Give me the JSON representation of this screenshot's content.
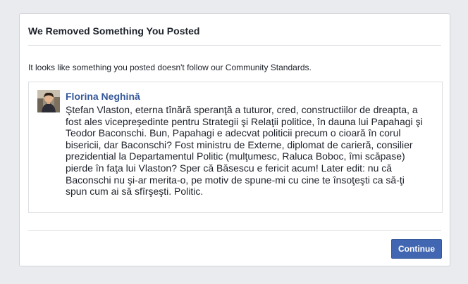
{
  "dialog": {
    "title": "We Removed Something You Posted",
    "message": "It looks like something you posted doesn't follow our Community Standards.",
    "continue_label": "Continue"
  },
  "post": {
    "author": "Florina Neghină",
    "text": "Ştefan Vlaston, eterna tînără speranţă a tuturor, cred, constructiilor de dreapta, a\nfost ales vicepreşedinte pentru Strategii şi Relaţii politice, în dauna lui Papahagi şi\nTeodor Baconschi. Bun, Papahagi e adecvat politicii precum o cioară în corul\nbisericii, dar Baconschi? Fost ministru de Externe, diplomat de carieră, consilier\nprezidential la Departamentul Politic (mulţumesc, Raluca Boboc, îmi scăpase)\npierde în faţa lui Vlaston? Sper că Băsescu e fericit acum! Later edit: nu că\nBaconschi nu şi-ar merita-o, pe motiv de spune-mi cu cine te însoţeşti ca să-ţi\nspun cum ai să sfîrşeşti. Politic.",
    "avatar_icon": "user-photo"
  },
  "colors": {
    "background": "#e9ebee",
    "author_link": "#365899",
    "button": "#4267b2"
  }
}
